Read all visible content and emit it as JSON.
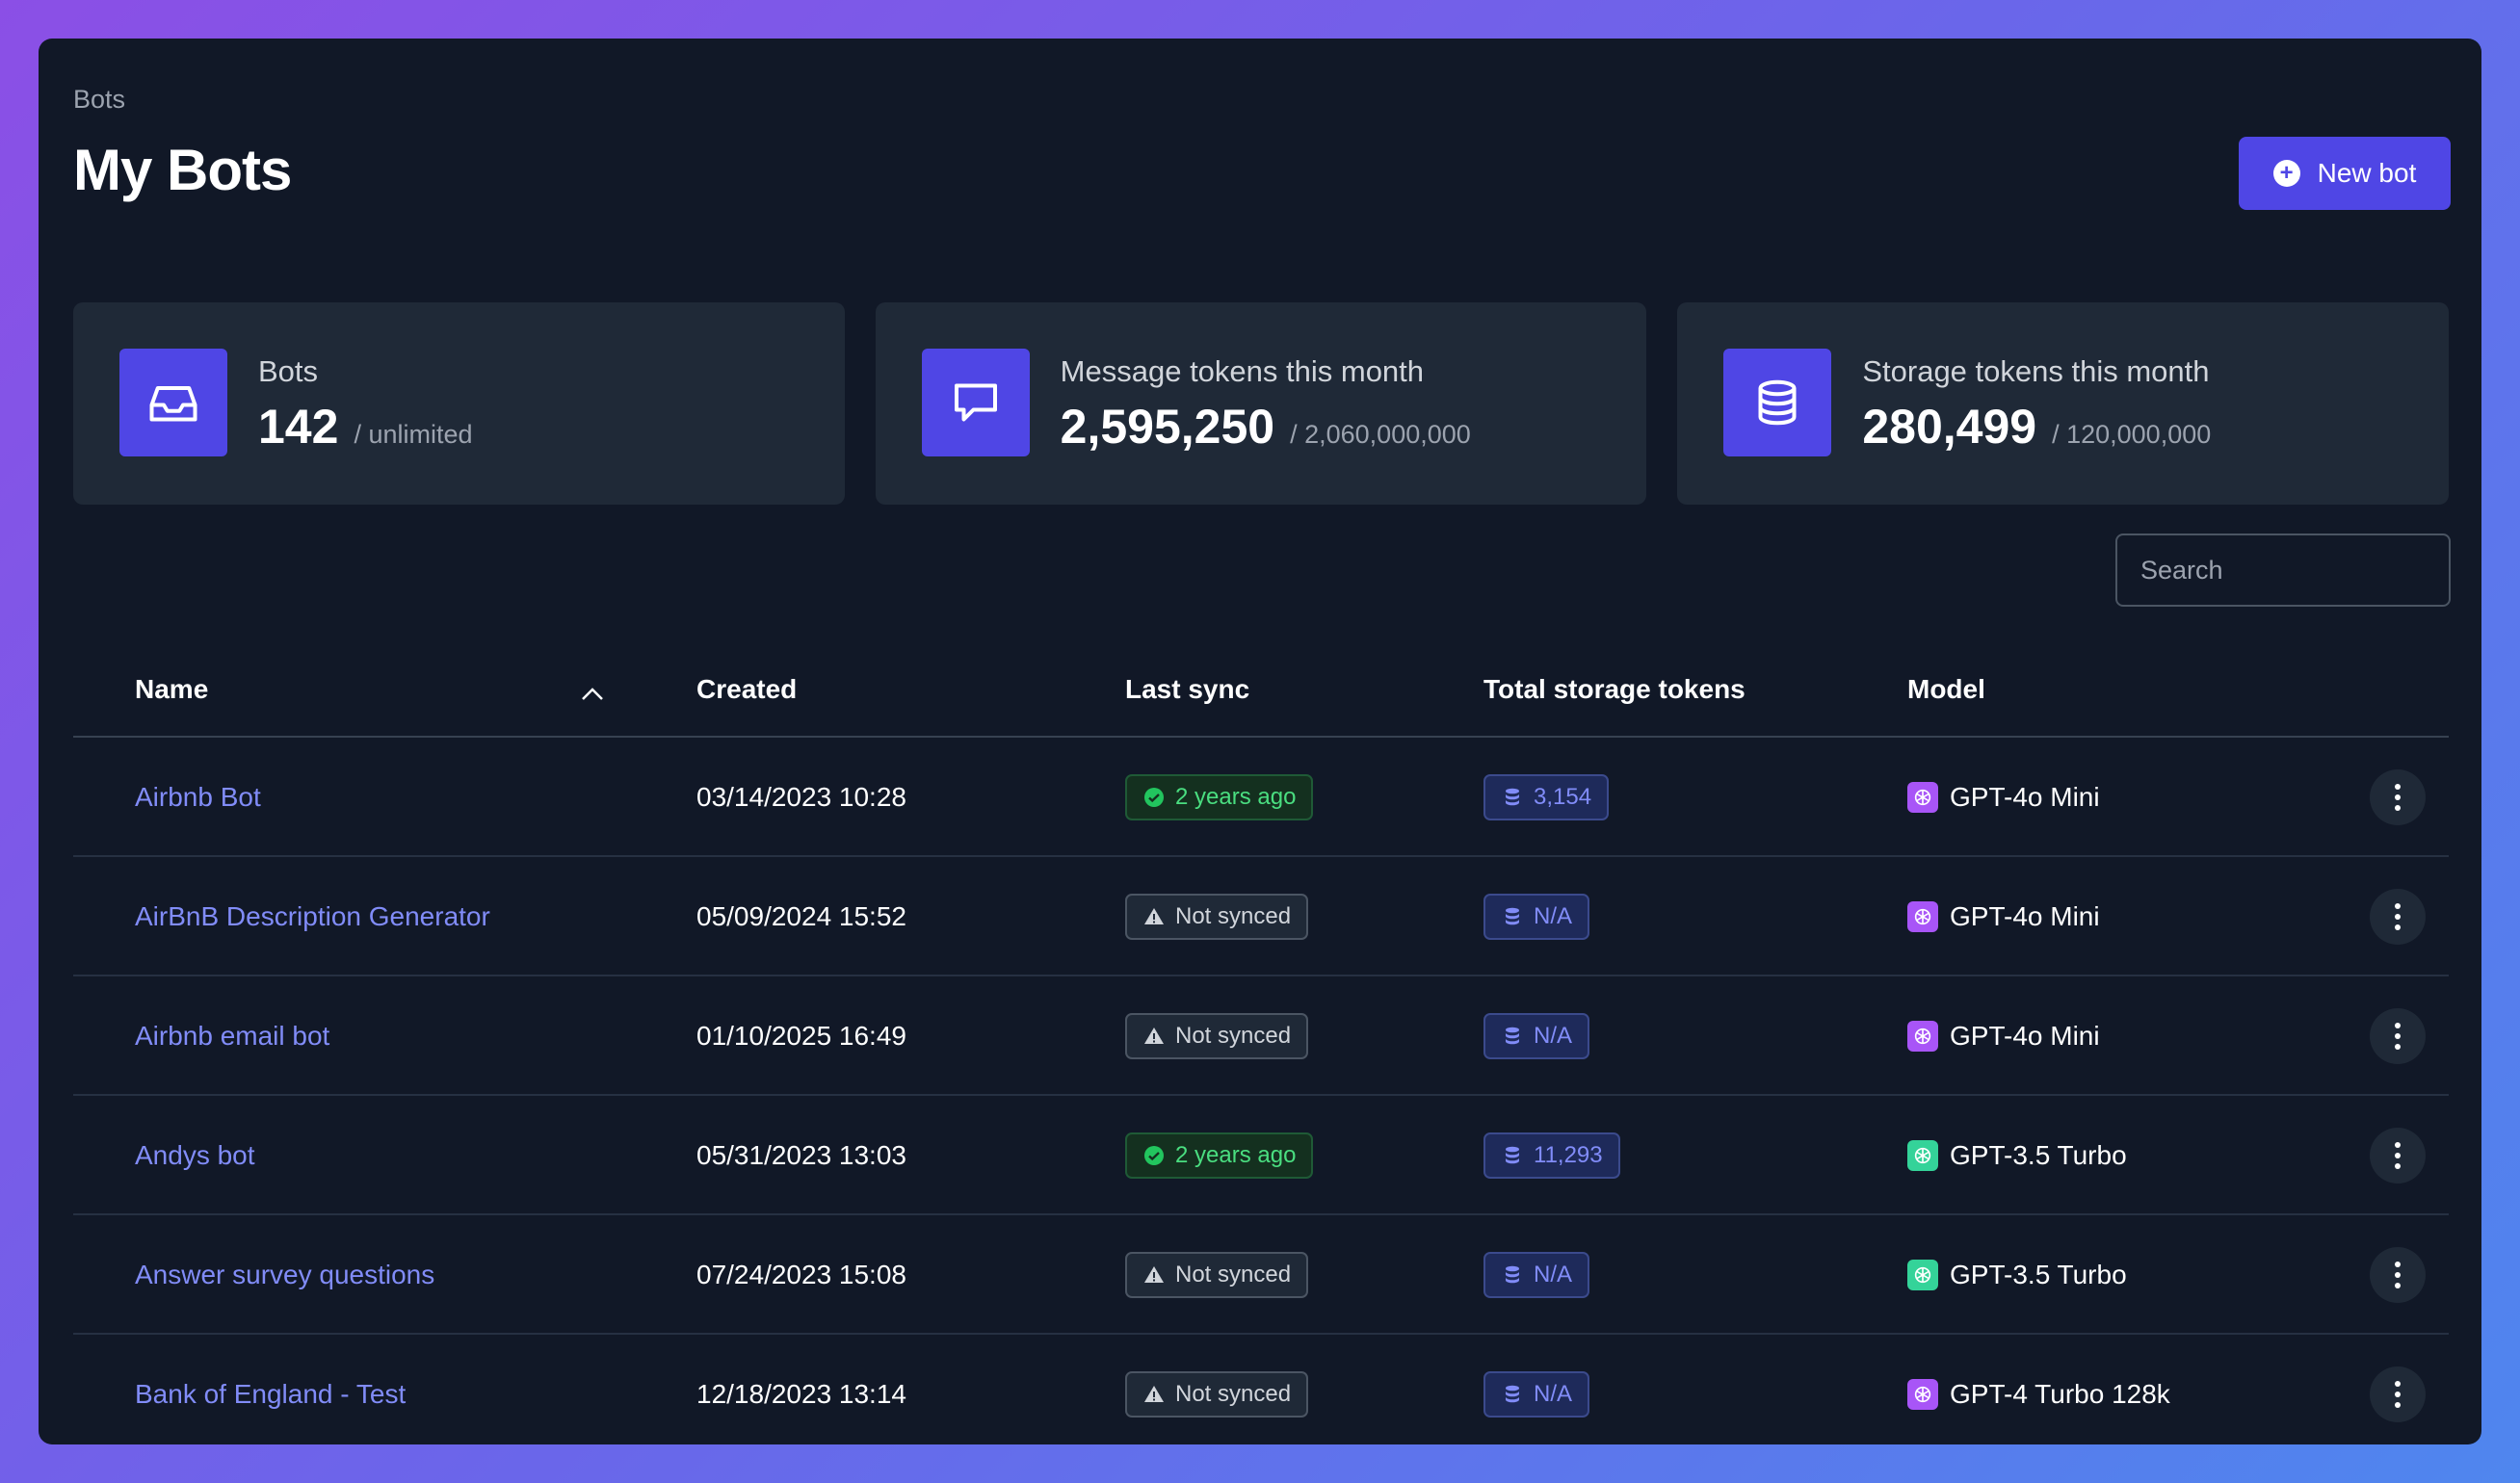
{
  "header": {
    "breadcrumb": "Bots",
    "title": "My Bots",
    "new_button_label": "New bot"
  },
  "stats": [
    {
      "label": "Bots",
      "value": "142",
      "limit": "/ unlimited",
      "icon": "inbox-icon"
    },
    {
      "label": "Message tokens this month",
      "value": "2,595,250",
      "limit": "/ 2,060,000,000",
      "icon": "chat-bubble-icon"
    },
    {
      "label": "Storage tokens this month",
      "value": "280,499",
      "limit": "/ 120,000,000",
      "icon": "database-icon"
    }
  ],
  "search": {
    "placeholder": "Search",
    "value": ""
  },
  "table": {
    "columns": [
      "Name",
      "Created",
      "Last sync",
      "Total storage tokens",
      "Model"
    ],
    "sort": {
      "column": "Name",
      "direction": "ascending"
    },
    "rows": [
      {
        "name": "Airbnb Bot",
        "created": "03/14/2023 10:28",
        "sync": "2 years ago",
        "synced": true,
        "tokens": "3,154",
        "model": "GPT-4o Mini"
      },
      {
        "name": "AirBnB Description Generator",
        "created": "05/09/2024 15:52",
        "sync": "Not synced",
        "synced": false,
        "tokens": "N/A",
        "model": "GPT-4o Mini"
      },
      {
        "name": "Airbnb email bot",
        "created": "01/10/2025 16:49",
        "sync": "Not synced",
        "synced": false,
        "tokens": "N/A",
        "model": "GPT-4o Mini"
      },
      {
        "name": "Andys bot",
        "created": "05/31/2023 13:03",
        "sync": "2 years ago",
        "synced": true,
        "tokens": "11,293",
        "model": "GPT-3.5 Turbo"
      },
      {
        "name": "Answer survey questions",
        "created": "07/24/2023 15:08",
        "sync": "Not synced",
        "synced": false,
        "tokens": "N/A",
        "model": "GPT-3.5 Turbo"
      },
      {
        "name": "Bank of England - Test",
        "created": "12/18/2023 13:14",
        "sync": "Not synced",
        "synced": false,
        "tokens": "N/A",
        "model": "GPT-4 Turbo 128k"
      }
    ]
  },
  "colors": {
    "accent": "#4f46e5",
    "link": "#818cf8",
    "success": "#4ade80",
    "gpt4_icon": "#a855f7",
    "gpt35_icon": "#34d399"
  }
}
